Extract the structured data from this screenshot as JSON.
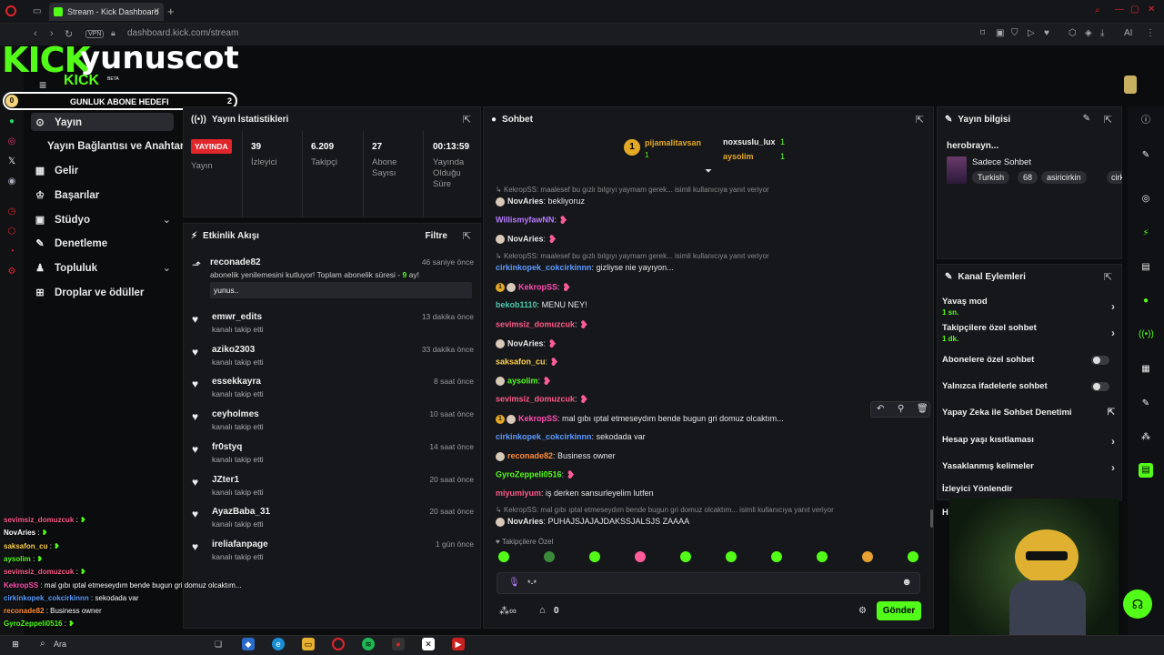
{
  "browser": {
    "tab_title": "Stream - Kick Dashboard",
    "url": "dashboard.kick.com/stream",
    "vpn": "VPN",
    "ai": "AI"
  },
  "overlay": {
    "logo_text": "KICK",
    "username": "yunuscot",
    "kick_small": "KICK",
    "beta": "BETA",
    "goal_title": "GUNLUK ABONE HEDEFI",
    "goal_current": "0",
    "goal_target": "2"
  },
  "nav": {
    "items": [
      {
        "label": "Yayın",
        "icon": "broadcast-icon"
      },
      {
        "label": "Yayın Bağlantısı ve Anahtarı",
        "icon": ""
      },
      {
        "label": "Gelir",
        "icon": "revenue-icon"
      },
      {
        "label": "Başarılar",
        "icon": "trophy-icon"
      },
      {
        "label": "Stüdyo",
        "icon": "studio-icon"
      },
      {
        "label": "Denetleme",
        "icon": "wrench-icon"
      },
      {
        "label": "Topluluk",
        "icon": "community-icon"
      },
      {
        "label": "Droplar ve ödüller",
        "icon": "gift-icon"
      }
    ]
  },
  "stats": {
    "title": "Yayın İstatistikleri",
    "live": "YAYINDA",
    "live_label": "Yayın",
    "viewers": "39",
    "viewers_label": "İzleyici",
    "followers": "6.209",
    "followers_label": "Takipçi",
    "subs": "27",
    "subs_label": "Abone Sayısı",
    "uptime": "00:13:59",
    "uptime_label": "Yayında Olduğu Süre"
  },
  "activity": {
    "title": "Etkinlik Akışı",
    "filter": "Filtre",
    "top": {
      "name": "reconade82",
      "time": "46 saniye önce",
      "text_pre": "abonelik yenilemesini kutluyor! Toplam abonelik süresi - ",
      "months": "9",
      "text_post": " ay!",
      "message": "yunus.."
    },
    "events": [
      {
        "name": "emwr_edits",
        "sub": "kanalı takip etti",
        "time": "13 dakika önce"
      },
      {
        "name": "aziko2303",
        "sub": "kanalı takip etti",
        "time": "33 dakika önce"
      },
      {
        "name": "essekkayra",
        "sub": "kanalı takip etti",
        "time": "8 saat önce"
      },
      {
        "name": "ceyholmes",
        "sub": "kanalı takip etti",
        "time": "10 saat önce"
      },
      {
        "name": "fr0styq",
        "sub": "kanalı takip etti",
        "time": "14 saat önce"
      },
      {
        "name": "JZter1",
        "sub": "kanalı takip etti",
        "time": "20 saat önce"
      },
      {
        "name": "AyazBaba_31",
        "sub": "kanalı takip etti",
        "time": "20 saat önce"
      },
      {
        "name": "ireliafanpage",
        "sub": "kanalı takip etti",
        "time": "1 gün önce"
      }
    ]
  },
  "chat": {
    "title": "Sohbet",
    "top_gifters": [
      {
        "rank": "1",
        "name": "pijamalitavsan",
        "count": "1"
      },
      {
        "name": "noxsuslu_lux",
        "count": "1"
      },
      {
        "name": "aysolim",
        "count": "1"
      }
    ],
    "messages": [
      {
        "reply": "KekropSS: maalesef bu gızlı bılgıyı yaymam gerek... isimli kullanıcıya yanıt veriyor"
      },
      {
        "user": "NovAries",
        "color": "#e6e6e6",
        "text": "bekliyoruz"
      },
      {
        "user": "WillismyfawNN",
        "color": "#b77bff",
        "text": ""
      },
      {
        "user": "NovAries",
        "color": "#e6e6e6",
        "text": ""
      },
      {
        "reply": "KekropSS: maalesef bu gızlı bılgıyı yaymam gerek... isimli kullanıcıya yanıt veriyor"
      },
      {
        "user": "cirkinkopek_cokcirkinnn",
        "color": "#5b9bff",
        "text": "gizliyse nie yayıyon..."
      },
      {
        "user": "KekropSS",
        "color": "#ff4fb3",
        "text": ""
      },
      {
        "user": "bekob1110",
        "color": "#4ec9b0",
        "text": "MENU NEY!"
      },
      {
        "user": "sevimsiz_domuzcuk",
        "color": "#ff5a8a",
        "text": ""
      },
      {
        "user": "NovAries",
        "color": "#e6e6e6",
        "text": ""
      },
      {
        "user": "saksafon_cu",
        "color": "#ffd24d",
        "text": ""
      },
      {
        "user": "aysolim",
        "color": "#53fc18",
        "text": ""
      },
      {
        "user": "sevimsiz_domuzcuk",
        "color": "#ff5a8a",
        "text": ""
      },
      {
        "user": "KekropSS",
        "color": "#ff4fb3",
        "text": "mal gıbı ıptal etmeseydım bende bugun gri domuz olcaktım..."
      },
      {
        "user": "cirkinkopek_cokcirkinnn",
        "color": "#5b9bff",
        "text": "sekodada var"
      },
      {
        "user": "reconade82",
        "color": "#ff8c3a",
        "text": "Business owner"
      },
      {
        "user": "GyroZeppeli0516",
        "color": "#53fc18",
        "text": ""
      },
      {
        "user": "miyumiyum",
        "color": "#ff5a8a",
        "text": "iş derken sansurleyelim lutfen"
      },
      {
        "reply": "KekropSS: mal gıbı ıptal etmeseydım bende bugun gri domuz olcaktım... isimli kullanıcıya yanıt veriyor"
      },
      {
        "user": "NovAries",
        "color": "#e6e6e6",
        "text": "PUHAJSJAJAJDAKSSJALSJS ZAAAA"
      }
    ],
    "followers_only": "Takipçilere Özel",
    "input_value": "*-*",
    "points": "0",
    "send": "Gönder"
  },
  "info": {
    "title": "Yayın bilgisi",
    "stream_title": "herobrayn...",
    "category": "Sadece Sohbet",
    "tags": [
      "Turkish",
      "68",
      "asiricirkin",
      "cirk"
    ]
  },
  "channel": {
    "title": "Kanal Eylemleri",
    "slow": "Yavaş mod",
    "slow_val": "1 sn.",
    "followers_chat": "Takipçilere özel sohbet",
    "followers_val": "1 dk.",
    "subs_chat": "Abonelere özel sohbet",
    "emote_chat": "Yalnızca ifadelerle sohbet",
    "ai_mod": "Yapay Zeka ile Sohbet Denetimi",
    "age": "Hesap yaşı kısıtlaması",
    "banned": "Yasaklanmış kelimeler",
    "redirect": "İzleyici Yönlendir",
    "h": "H"
  },
  "overlay_chat": [
    {
      "user": "sevimsiz_domuzcuk",
      "text": ""
    },
    {
      "user": "NovAries",
      "text": ""
    },
    {
      "user": "saksafon_cu",
      "text": ""
    },
    {
      "user": "aysolim",
      "text": ""
    },
    {
      "user": "sevimsiz_domuzcuk",
      "text": ""
    },
    {
      "user": "KekropSS",
      "text": "mal gıbı ıptal etmeseydım bende bugun gri domuz olcaktım..."
    },
    {
      "user": "cirkinkopek_cokcirkinnn",
      "text": "sekodada var"
    },
    {
      "user": "reconade82",
      "text": "Business owner"
    },
    {
      "user": "GyroZeppeli0516",
      "text": ""
    }
  ],
  "taskbar": {
    "search": "Ara"
  },
  "colors": {
    "kick_green": "#53fc18",
    "live_red": "#e0252b",
    "panel": "#16171b"
  }
}
